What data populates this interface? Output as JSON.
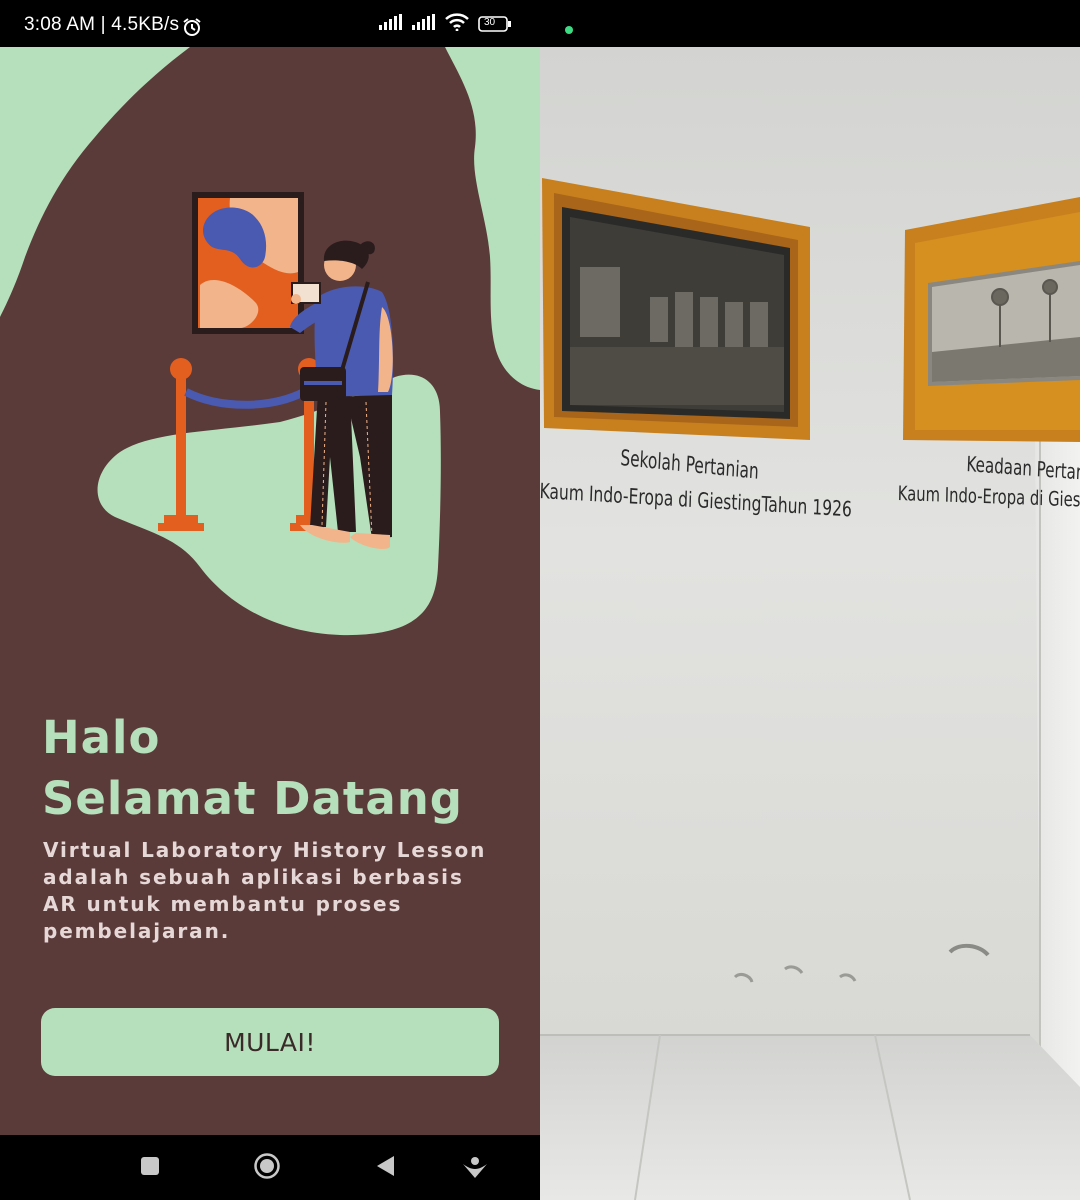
{
  "status_bar": {
    "time_speed": "3:08 AM | 4.5KB/s",
    "battery": "30"
  },
  "welcome": {
    "title_line1": "Halo",
    "title_line2": "Selamat Datang",
    "description": "Virtual Laboratory History Lesson adalah sebuah aplikasi berbasis AR untuk membantu proses pembelajaran.",
    "start_label": "MULAI!"
  },
  "ar_view": {
    "frame1_title": "Sekolah Pertanian",
    "frame1_subtitle": "Kaum Indo-Eropa di GiestingTahun 1926",
    "frame2_title": "Keadaan Pertani",
    "frame2_subtitle": "Kaum Indo-Eropa di Giestin"
  },
  "colors": {
    "background": "#5b3a3a",
    "accent_green": "#b5e0bb",
    "orange": "#e35f1f",
    "blue": "#4a5ab0",
    "frame_gold": "#c8801f"
  },
  "icons": {
    "alarm": "alarm-icon",
    "signal": "signal-icon",
    "wifi": "wifi-icon",
    "battery": "battery-icon",
    "recents": "square-icon",
    "home": "circle-icon",
    "back": "triangle-back-icon",
    "assist": "assistant-icon"
  }
}
